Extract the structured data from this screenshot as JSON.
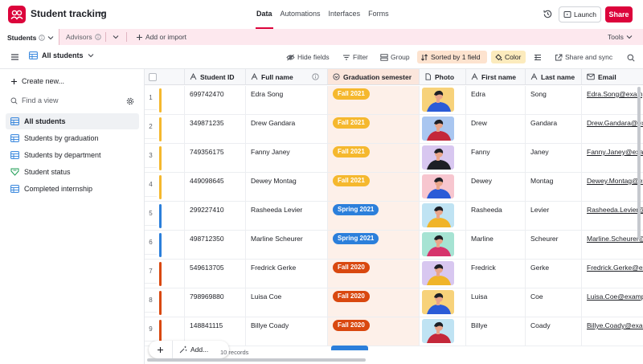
{
  "app": {
    "base_title": "Student tracking",
    "logo_icon": "airtable-logo-icon",
    "brand_color": "#dc043b"
  },
  "top_tabs": [
    {
      "label": "Data",
      "active": true
    },
    {
      "label": "Automations",
      "active": false
    },
    {
      "label": "Interfaces",
      "active": false
    },
    {
      "label": "Forms",
      "active": false
    }
  ],
  "top_actions": {
    "launch": "Launch",
    "share": "Share"
  },
  "tables": {
    "active": "Students",
    "second": "Advisors",
    "add": "Add or import",
    "tools": "Tools"
  },
  "toolbar": {
    "view_name": "All students",
    "hide_fields": "Hide fields",
    "filter": "Filter",
    "group": "Group",
    "sorted": "Sorted by 1 field",
    "color": "Color",
    "share_sync": "Share and sync"
  },
  "sidebar": {
    "create_new": "Create new...",
    "find_placeholder": "Find a view",
    "views": [
      {
        "label": "All students",
        "icon": "grid-view-icon",
        "active": true
      },
      {
        "label": "Students by graduation",
        "icon": "grid-view-icon",
        "active": false
      },
      {
        "label": "Students by department",
        "icon": "grid-view-icon",
        "active": false
      },
      {
        "label": "Student status",
        "icon": "form-view-icon",
        "active": false
      },
      {
        "label": "Completed internship",
        "icon": "grid-view-icon",
        "active": false
      }
    ]
  },
  "columns": {
    "student_id": "Student ID",
    "full_name": "Full name",
    "graduation": "Graduation semester",
    "photo": "Photo",
    "first_name": "First name",
    "last_name": "Last name",
    "email": "Email"
  },
  "semester_colors": {
    "Fall 2021": "#f5b82e",
    "Spring 2021": "#2b7fdb",
    "Fall 2020": "#d9480f"
  },
  "rows": [
    {
      "num": "1",
      "student_id": "699742470",
      "full_name": "Edra Song",
      "semester": "Fall 2021",
      "first": "Edra",
      "last": "Song",
      "email": "Edra.Song@example.com",
      "photo_bg": "#f7d27a",
      "photo_fg": "#2a5bd7"
    },
    {
      "num": "2",
      "student_id": "349871235",
      "full_name": "Drew Gandara",
      "semester": "Fall 2021",
      "first": "Drew",
      "last": "Gandara",
      "email": "Drew.Gandara@example.com",
      "photo_bg": "#a9c6f0",
      "photo_fg": "#c4283a"
    },
    {
      "num": "3",
      "student_id": "749356175",
      "full_name": "Fanny Janey",
      "semester": "Fall 2021",
      "first": "Fanny",
      "last": "Janey",
      "email": "Fanny.Janey@example.com",
      "photo_bg": "#d8c7f0",
      "photo_fg": "#1d1f25"
    },
    {
      "num": "4",
      "student_id": "449098645",
      "full_name": "Dewey Montag",
      "semester": "Fall 2021",
      "first": "Dewey",
      "last": "Montag",
      "email": "Dewey.Montag@example.com",
      "photo_bg": "#f7c6cf",
      "photo_fg": "#2a5bd7"
    },
    {
      "num": "5",
      "student_id": "299227410",
      "full_name": "Rasheeda Levier",
      "semester": "Spring 2021",
      "first": "Rasheeda",
      "last": "Levier",
      "email": "Rasheeda.Levier@example.com",
      "photo_bg": "#bfe3f3",
      "photo_fg": "#f0b429"
    },
    {
      "num": "6",
      "student_id": "498712350",
      "full_name": "Marline Scheurer",
      "semester": "Spring 2021",
      "first": "Marline",
      "last": "Scheurer",
      "email": "Marline.Scheurer@example.com",
      "photo_bg": "#a6e3d3",
      "photo_fg": "#d6336c"
    },
    {
      "num": "7",
      "student_id": "549613705",
      "full_name": "Fredrick Gerke",
      "semester": "Fall 2020",
      "first": "Fredrick",
      "last": "Gerke",
      "email": "Fredrick.Gerke@example.com",
      "photo_bg": "#d8c7f0",
      "photo_fg": "#f0b429"
    },
    {
      "num": "8",
      "student_id": "798969880",
      "full_name": "Luisa Coe",
      "semester": "Fall 2020",
      "first": "Luisa",
      "last": "Coe",
      "email": "Luisa.Coe@example.com",
      "photo_bg": "#f7d27a",
      "photo_fg": "#2a5bd7"
    },
    {
      "num": "9",
      "student_id": "148841115",
      "full_name": "Billye Coady",
      "semester": "Fall 2020",
      "first": "Billye",
      "last": "Coady",
      "email": "Billye.Coady@example.com",
      "photo_bg": "#bfe3f3",
      "photo_fg": "#c4283a"
    }
  ],
  "footer": {
    "add_label": "Add...",
    "record_count": "10 records"
  }
}
